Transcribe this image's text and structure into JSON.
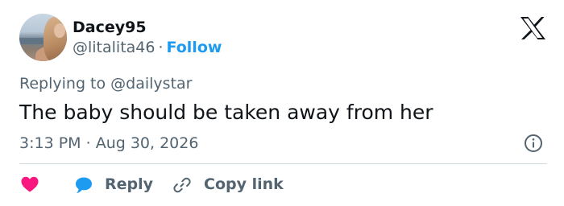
{
  "user": {
    "display_name": "Dacey95",
    "handle": "@litalita46",
    "separator": "·",
    "follow_label": "Follow"
  },
  "reply_context": {
    "prefix": "Replying to",
    "mention": "@dailystar"
  },
  "tweet": {
    "text": "The baby should be taken away from her",
    "time": "3:13 PM",
    "separator": "·",
    "date": "Aug 30, 2026"
  },
  "actions": {
    "reply_label": "Reply",
    "copy_link_label": "Copy link"
  },
  "icons": {
    "brand": "x-logo-icon",
    "info": "info-icon",
    "like": "heart-icon",
    "reply": "speech-bubble-icon",
    "copy": "link-icon"
  },
  "colors": {
    "text_primary": "#0f1419",
    "text_secondary": "#536471",
    "accent": "#1d9bf0",
    "heart": "#f91880",
    "divider": "#cfd9de"
  }
}
